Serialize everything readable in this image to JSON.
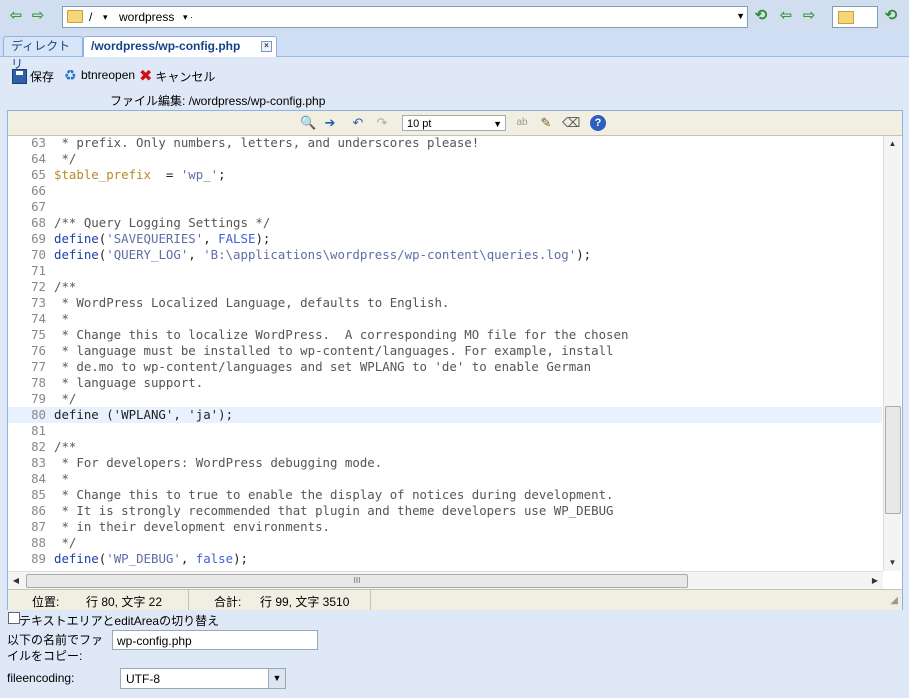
{
  "nav": {
    "path_root": "/",
    "path_folder": "wordpress",
    "path_sep": "▾  ·"
  },
  "tabs": [
    {
      "label": "ディレクトリ"
    },
    {
      "label": "/wordpress/wp-config.php"
    }
  ],
  "actions": {
    "save": "保存",
    "reopen": "btnreopen",
    "cancel": "キャンセル"
  },
  "file_label": "ファイル編集: /wordpress/wp-config.php",
  "editor": {
    "font_size": "10 pt",
    "lines": [
      {
        "n": "63",
        "t": " * prefix. Only numbers, letters, and underscores please!",
        "k": "cmt"
      },
      {
        "n": "64",
        "t": " */",
        "k": "cmt"
      },
      {
        "n": "65",
        "t": "",
        "k": "prefix"
      },
      {
        "n": "66",
        "t": "",
        "k": "plain"
      },
      {
        "n": "67",
        "t": "",
        "k": "plain"
      },
      {
        "n": "68",
        "t": "/** Query Logging Settings */",
        "k": "cmt"
      },
      {
        "n": "69",
        "t": "",
        "k": "savequeries"
      },
      {
        "n": "70",
        "t": "",
        "k": "querylog"
      },
      {
        "n": "71",
        "t": "",
        "k": "plain"
      },
      {
        "n": "72",
        "t": "/**",
        "k": "cmt"
      },
      {
        "n": "73",
        "t": " * WordPress Localized Language, defaults to English.",
        "k": "cmt"
      },
      {
        "n": "74",
        "t": " *",
        "k": "cmt"
      },
      {
        "n": "75",
        "t": " * Change this to localize WordPress.  A corresponding MO file for the chosen",
        "k": "cmt"
      },
      {
        "n": "76",
        "t": " * language must be installed to wp-content/languages. For example, install",
        "k": "cmt"
      },
      {
        "n": "77",
        "t": " * de.mo to wp-content/languages and set WPLANG to 'de' to enable German",
        "k": "cmt"
      },
      {
        "n": "78",
        "t": " * language support.",
        "k": "cmt"
      },
      {
        "n": "79",
        "t": " */",
        "k": "cmt"
      },
      {
        "n": "80",
        "t": "define ('WPLANG', 'ja');",
        "k": "active"
      },
      {
        "n": "81",
        "t": "",
        "k": "plain"
      },
      {
        "n": "82",
        "t": "/**",
        "k": "cmt"
      },
      {
        "n": "83",
        "t": " * For developers: WordPress debugging mode.",
        "k": "cmt"
      },
      {
        "n": "84",
        "t": " *",
        "k": "cmt"
      },
      {
        "n": "85",
        "t": " * Change this to true to enable the display of notices during development.",
        "k": "cmt"
      },
      {
        "n": "86",
        "t": " * It is strongly recommended that plugin and theme developers use WP_DEBUG",
        "k": "cmt"
      },
      {
        "n": "87",
        "t": " * in their development environments.",
        "k": "cmt"
      },
      {
        "n": "88",
        "t": " */",
        "k": "cmt"
      },
      {
        "n": "89",
        "t": "",
        "k": "debug"
      }
    ],
    "tokens": {
      "prefix_var": "$table_prefix",
      "prefix_rest": "  = ",
      "prefix_val": "'wp_'",
      "semi": ";",
      "define": "define",
      "savequeries_key": "'SAVEQUERIES'",
      "savequeries_val": "FALSE",
      "querylog_key": "'QUERY_LOG'",
      "querylog_val": "'B:\\applications\\wordpress/wp-content\\queries.log'",
      "debug_key": "'WP_DEBUG'",
      "debug_val": "false"
    }
  },
  "status": {
    "pos_label": "位置:",
    "pos_value": "行 80, 文字 22",
    "total_label": "合計:",
    "total_value": "行 99, 文字 3510"
  },
  "form": {
    "toggle_label": "テキストエリアとeditAreaの切り替え",
    "copy_label": "以下の名前でファイルをコピー:",
    "copy_value": "wp-config.php",
    "encoding_label": "fileencoding:",
    "encoding_value": "UTF-8"
  }
}
